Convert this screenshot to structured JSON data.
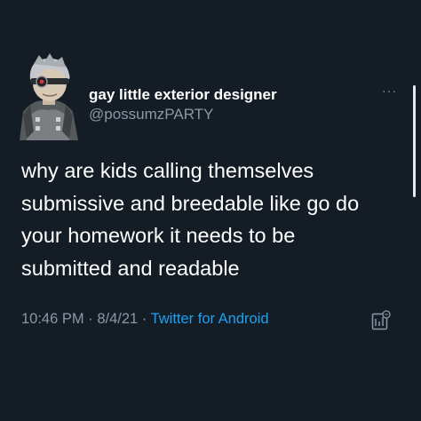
{
  "tweet": {
    "display_name": "gay little exterior designer",
    "handle": "@possumzPARTY",
    "body_lines": [
      "why are kids calling themselves",
      "submissive and breedable like go do",
      "your homework it needs to be",
      "submitted and readable"
    ],
    "time": "10:46 PM",
    "date": "8/4/21",
    "separator": "·",
    "source": "Twitter for Android",
    "more_label": "···"
  },
  "icons": {
    "avatar": "avatar",
    "more": "more-options-icon",
    "analytics": "analytics-icon"
  },
  "colors": {
    "background": "#141d26",
    "text": "#ffffff",
    "secondary_text": "#8899a6",
    "link": "#1da1f2"
  }
}
